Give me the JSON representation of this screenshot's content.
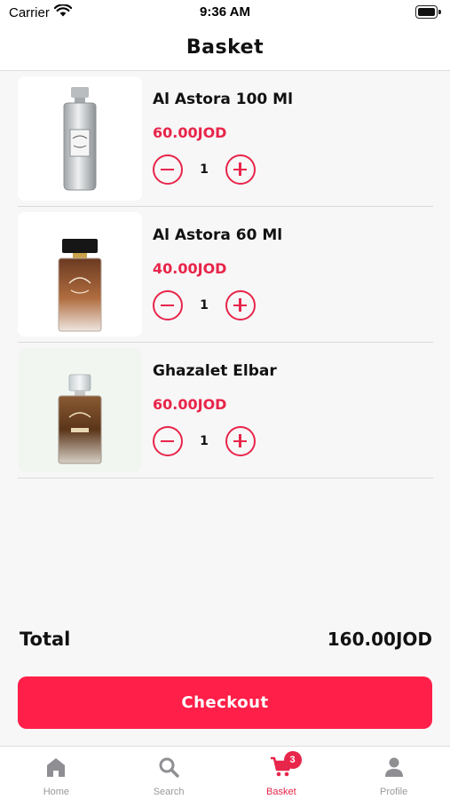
{
  "status_bar": {
    "carrier": "Carrier",
    "time": "9:36 AM"
  },
  "header": {
    "title": "Basket"
  },
  "items": [
    {
      "name": "Al Astora 100 Ml",
      "price": "60.00JOD",
      "quantity": "1",
      "image": "silver-perfume-bottle"
    },
    {
      "name": "Al Astora 60 Ml",
      "price": "40.00JOD",
      "quantity": "1",
      "image": "amber-perfume-bottle-black-cap"
    },
    {
      "name": "Ghazalet Elbar",
      "price": "60.00JOD",
      "quantity": "1",
      "image": "amber-perfume-bottle-clear-cap"
    }
  ],
  "summary": {
    "total_label": "Total",
    "total_value": "160.00JOD"
  },
  "checkout": {
    "label": "Checkout"
  },
  "tab_bar": {
    "tabs": [
      {
        "label": "Home",
        "icon": "home-icon",
        "active": false
      },
      {
        "label": "Search",
        "icon": "search-icon",
        "active": false
      },
      {
        "label": "Basket",
        "icon": "cart-icon",
        "active": true,
        "badge": "3"
      },
      {
        "label": "Profile",
        "icon": "person-icon",
        "active": false
      }
    ]
  },
  "colors": {
    "accent": "#e8254a",
    "checkout": "#ff1f48"
  }
}
